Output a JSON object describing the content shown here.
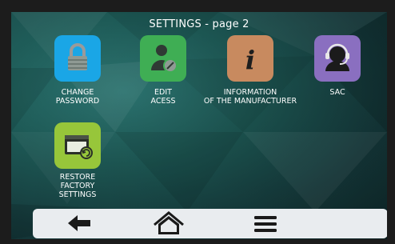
{
  "screen": {
    "title": "SETTINGS - page 2"
  },
  "tiles": [
    {
      "name": "change-password",
      "icon": "lock-icon",
      "color": "#1aa6e6",
      "label_line1": "CHANGE",
      "label_line2": "PASSWORD"
    },
    {
      "name": "edit-access",
      "icon": "user-edit-icon",
      "color": "#3fae54",
      "label_line1": "EDIT",
      "label_line2": "ACESS"
    },
    {
      "name": "manufacturer-info",
      "icon": "info-icon",
      "color": "#c88a5f",
      "label_line1": "INFORMATION",
      "label_line2": "OF THE MANUFACTURER"
    },
    {
      "name": "sac",
      "icon": "headset-icon",
      "color": "#8a6fc0",
      "label_line1": "SAC",
      "label_line2": ""
    },
    {
      "name": "restore-factory",
      "icon": "restore-window-icon",
      "color": "#97c63a",
      "label_line1": "RESTORE",
      "label_line2": "FACTORY",
      "label_line3": "SETTINGS"
    }
  ],
  "navbar": {
    "back": "back-arrow-icon",
    "home": "home-icon",
    "menu": "menu-icon"
  }
}
